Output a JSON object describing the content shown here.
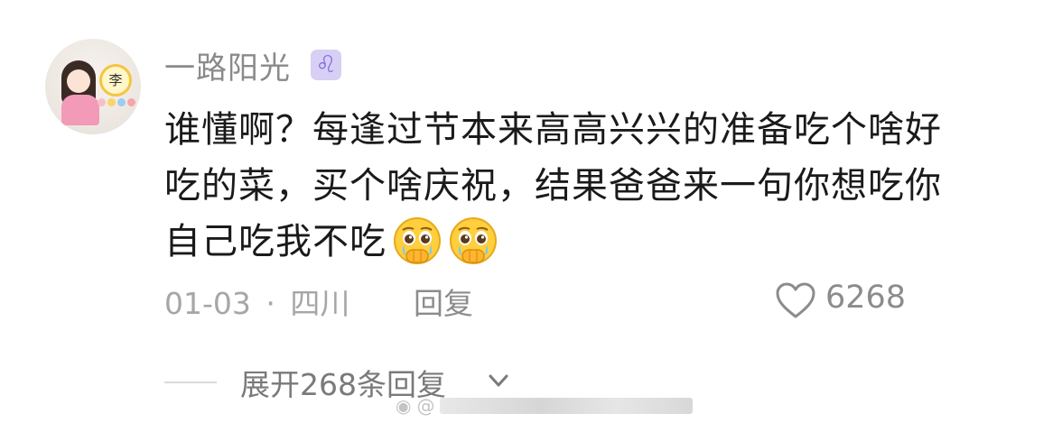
{
  "comment": {
    "username": "一路阳光",
    "zodiac_symbol": "♌",
    "avatar_badge_char": "李",
    "lines": [
      "谁懂啊？每逢过节本来高高兴兴的准备吃个啥好",
      "吃的菜，买个啥庆祝，结果爸爸来一句你想吃你",
      "自己吃我不吃"
    ],
    "emojis": [
      "crying-face-holding-back-tears",
      "crying-face-holding-back-tears"
    ],
    "date": "01-03",
    "separator": "·",
    "location": "四川",
    "reply_label": "回复",
    "likes": "6268",
    "expand_label": "展开268条回复"
  },
  "watermark": {
    "prefix": "@"
  },
  "colors": {
    "primary_text": "#1a1a1a",
    "secondary_text": "#8a8a8a",
    "zodiac_bg": "#d8cff4",
    "zodiac_fg": "#8a6ee0"
  }
}
